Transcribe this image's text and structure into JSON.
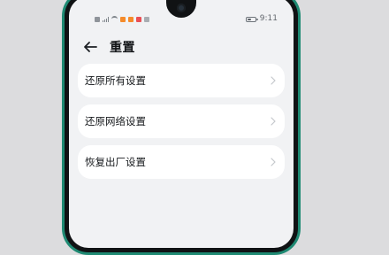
{
  "status_bar": {
    "time": "9:11"
  },
  "header": {
    "back_icon": "arrow-left-icon",
    "title": "重置"
  },
  "settings_items": [
    {
      "label": "还原所有设置",
      "icon": "chevron-right-icon"
    },
    {
      "label": "还原网络设置",
      "icon": "chevron-right-icon"
    },
    {
      "label": "恢复出厂设置",
      "icon": "chevron-right-icon"
    }
  ],
  "colors": {
    "frame_green": "#1f8a73",
    "screen_background": "#f1f2f4",
    "card_background": "#ffffff",
    "primary_text": "#171a1d",
    "chevron": "#c4c7cc"
  }
}
